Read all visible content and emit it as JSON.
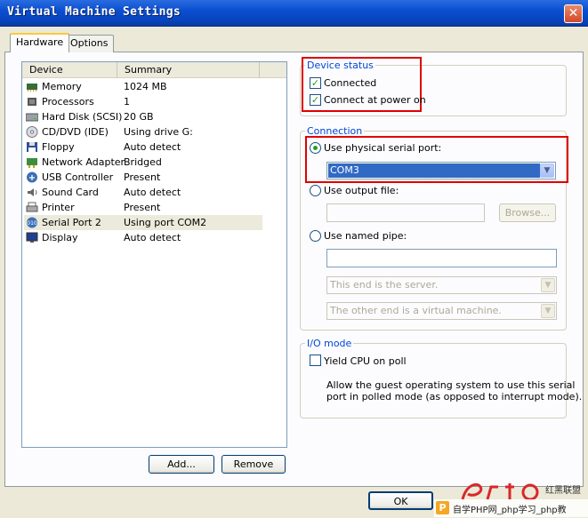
{
  "window": {
    "title": "Virtual Machine Settings"
  },
  "tabs": [
    {
      "label": "Hardware"
    },
    {
      "label": "Options"
    }
  ],
  "device_list": {
    "headers": {
      "device": "Device",
      "summary": "Summary"
    },
    "rows": [
      {
        "device": "Memory",
        "summary": "1024 MB",
        "icon": "memory-icon"
      },
      {
        "device": "Processors",
        "summary": "1",
        "icon": "processor-icon"
      },
      {
        "device": "Hard Disk (SCSI)",
        "summary": "20 GB",
        "icon": "hard-disk-icon"
      },
      {
        "device": "CD/DVD (IDE)",
        "summary": "Using drive G:",
        "icon": "cd-dvd-icon"
      },
      {
        "device": "Floppy",
        "summary": "Auto detect",
        "icon": "floppy-icon"
      },
      {
        "device": "Network Adapter",
        "summary": "Bridged",
        "icon": "network-adapter-icon"
      },
      {
        "device": "USB Controller",
        "summary": "Present",
        "icon": "usb-icon"
      },
      {
        "device": "Sound Card",
        "summary": "Auto detect",
        "icon": "sound-card-icon"
      },
      {
        "device": "Printer",
        "summary": "Present",
        "icon": "printer-icon"
      },
      {
        "device": "Serial Port 2",
        "summary": "Using port COM2",
        "icon": "serial-port-icon"
      },
      {
        "device": "Display",
        "summary": "Auto detect",
        "icon": "display-icon"
      }
    ],
    "selected_index": 9
  },
  "buttons": {
    "add": "Add...",
    "remove": "Remove",
    "ok": "OK",
    "browse": "Browse..."
  },
  "device_status": {
    "legend": "Device status",
    "connected": {
      "label": "Connected",
      "checked": true
    },
    "connect_at_power_on": {
      "label": "Connect at power on",
      "checked": true
    }
  },
  "connection": {
    "legend": "Connection",
    "physical_port": {
      "label": "Use physical serial port:",
      "selected": true,
      "value": "COM3"
    },
    "output_file": {
      "label": "Use output file:",
      "selected": false,
      "value": ""
    },
    "named_pipe": {
      "label": "Use named pipe:",
      "selected": false,
      "value": "",
      "end_option": "This end is the server.",
      "other_end_option": "The other end is a virtual machine."
    }
  },
  "io_mode": {
    "legend": "I/O mode",
    "yield_cpu": {
      "label": "Yield CPU on poll",
      "checked": false
    },
    "description": [
      "Allow the guest operating system to use this serial",
      "port in polled mode (as opposed to interrupt mode)."
    ]
  },
  "watermark": {
    "text": "自学PHP网_php学习_php教",
    "corner_text": "红黑联盟"
  },
  "colors": {
    "accent": "#0046d5",
    "highlight": "#e00000",
    "selection": "#316ac5"
  }
}
